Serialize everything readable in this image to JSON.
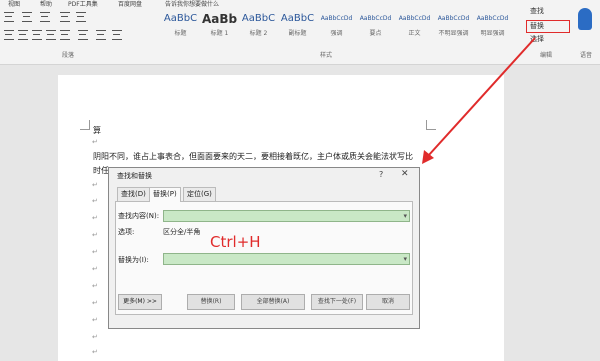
{
  "menu": [
    "视图",
    "帮助",
    "PDF工具集",
    "百度网盘",
    "告诉我你想要做什么"
  ],
  "ribbon": {
    "paragraph_group_label": "段落",
    "styles_group_label": "样式",
    "editing_group_label": "编辑",
    "voice_group_label": "语音",
    "styles": [
      {
        "sample": "AaBbC",
        "label": "标题"
      },
      {
        "sample": "AaBb",
        "label": "标题 1"
      },
      {
        "sample": "AaBbC",
        "label": "标题 2"
      },
      {
        "sample": "AaBbC",
        "label": "副标题"
      },
      {
        "sample": "AaBbCcDd",
        "label": "强调"
      },
      {
        "sample": "AaBbCcDd",
        "label": "要点"
      },
      {
        "sample": "AaBbCcDd",
        "label": "正文"
      },
      {
        "sample": "AaBbCcDd",
        "label": "不明显强调"
      },
      {
        "sample": "AaBbCcDd",
        "label": "明显强调"
      }
    ],
    "editing": {
      "find": "查找",
      "replace": "替换",
      "select": "选择"
    }
  },
  "document": {
    "lines": [
      "算",
      "阴阳不同，谁占上事表合，但面面要来的天二，要相接着既亿，主户体或质关会能法状写比",
      "时任"
    ]
  },
  "dialog": {
    "title": "查找和替换",
    "help": "?",
    "close": "✕",
    "tabs": [
      "查找(D)",
      "替换(P)",
      "定位(G)"
    ],
    "find_label": "查找内容(N):",
    "options_label": "选项:",
    "options_value": "区分全/半角",
    "replace_label": "替换为(I):",
    "annotation": "Ctrl+H",
    "buttons": {
      "more": "更多(M) >>",
      "replace": "替换(R)",
      "replace_all": "全部替换(A)",
      "find_next": "查找下一处(F)",
      "cancel": "取消"
    }
  },
  "colors": {
    "highlight": "#e02b2b",
    "input_green": "#c9e8c6",
    "accent": "#2b579a"
  }
}
